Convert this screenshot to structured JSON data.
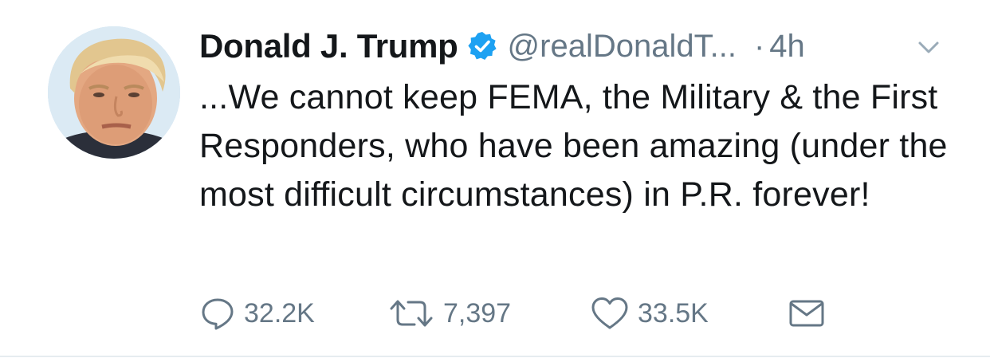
{
  "tweet": {
    "author_name": "Donald J. Trump",
    "handle": "@realDonaldT...",
    "separator": "·",
    "time": "4h",
    "text": "...We cannot keep FEMA, the Military & the First Responders, who have been amazing (under the most difficult circumstances) in P.R. forever!",
    "verified": true
  },
  "actions": {
    "reply_count": "32.2K",
    "retweet_count": "7,397",
    "like_count": "33.5K"
  },
  "icons": {
    "avatar": "profile-photo",
    "verified": "verified-badge-icon",
    "caret": "chevron-down-icon",
    "reply": "reply-icon",
    "retweet": "retweet-icon",
    "like": "heart-icon",
    "dm": "envelope-icon"
  },
  "colors": {
    "text": "#14171a",
    "secondary": "#657786",
    "verified_blue": "#1da1f2",
    "divider": "#e6ecf0"
  }
}
